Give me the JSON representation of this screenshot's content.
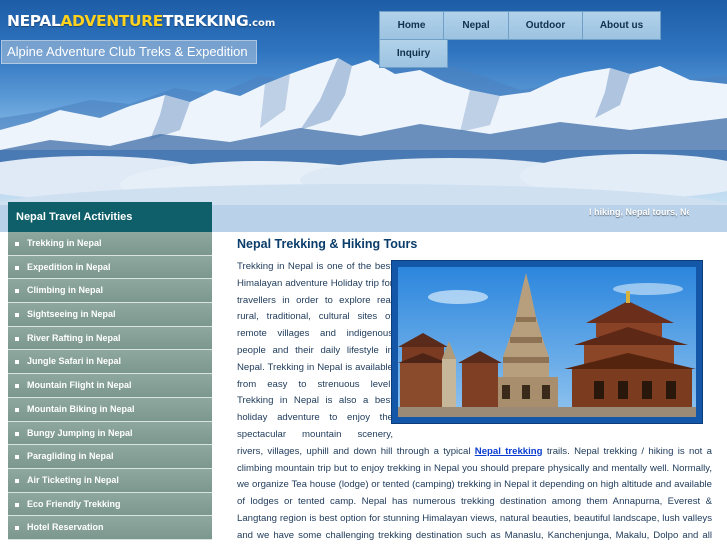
{
  "header": {
    "logo": {
      "part1": "NEPAL",
      "part2": "ADVENTURE",
      "part3": "TREKKING",
      "suffix": ".com"
    },
    "tagline": "Alpine Adventure Club Treks & Expedition",
    "ticker": "l hiking, Nepal tours, Ne"
  },
  "nav": {
    "items": [
      {
        "id": "home",
        "label": "Home"
      },
      {
        "id": "nepal",
        "label": "Nepal"
      },
      {
        "id": "outdoor",
        "label": "Outdoor"
      },
      {
        "id": "about",
        "label": "About us"
      },
      {
        "id": "inquiry",
        "label": "Inquiry"
      }
    ]
  },
  "sidebar": {
    "title": "Nepal Travel Activities",
    "items": [
      {
        "label": "Trekking in Nepal"
      },
      {
        "label": "Expedition in Nepal"
      },
      {
        "label": "Climbing in Nepal"
      },
      {
        "label": "Sightseeing in Nepal"
      },
      {
        "label": "River Rafting in Nepal"
      },
      {
        "label": "Jungle Safari in Nepal"
      },
      {
        "label": "Mountain Flight in Nepal"
      },
      {
        "label": "Mountain Biking in Nepal"
      },
      {
        "label": "Bungy Jumping in Nepal"
      },
      {
        "label": "Paragliding in Nepal"
      },
      {
        "label": "Air Ticketing in Nepal"
      },
      {
        "label": "Eco Friendly Trekking"
      },
      {
        "label": "Hotel Reservation"
      }
    ]
  },
  "main": {
    "title": "Nepal Trekking & Hiking Tours",
    "paragraph_before_link": "Trekking in Nepal is one of the best Himalayan adventure Holiday trip for travellers in order to explore real rural, traditional, cultural sites of remote villages and indigenous people and their daily lifestyle in Nepal. Trekking in Nepal is available from easy to strenuous level. Trekking in Nepal is also a best holiday adventure to enjoy the spectacular mountain scenery, rivers, villages, uphill and down hill through a typical ",
    "link_text": "Nepal trekking",
    "paragraph_after_link": " trails. Nepal trekking / hiking is not a climbing mountain trip but to enjoy trekking in Nepal you should prepare physically and mentally well. Normally, we organize Tea house (lodge) or tented (camping) trekking in Nepal it depending on high altitude and available of lodges or tented camp. Nepal has numerous trekking destination among them Annapurna, Everest & Langtang region is best option for stunning Himalayan views, natural beauties, beautiful landscape, lush valleys and we have some challenging trekking destination such as Manaslu, Kanchenjunga, Makalu, Dolpo and all other trekking route around the Nepal Himalayas."
  },
  "colors": {
    "sidebar_header": "#0e5f69",
    "sidebar_item": "#8ea89f",
    "nav_button": "#a6c9e4",
    "title_text": "#0b3d6b",
    "link": "#0a3cd0",
    "logo_accent": "#ffd21e",
    "photo_frame": "#1456a8"
  },
  "icons": {
    "sidebar_bullet": "square-bullet-icon"
  }
}
